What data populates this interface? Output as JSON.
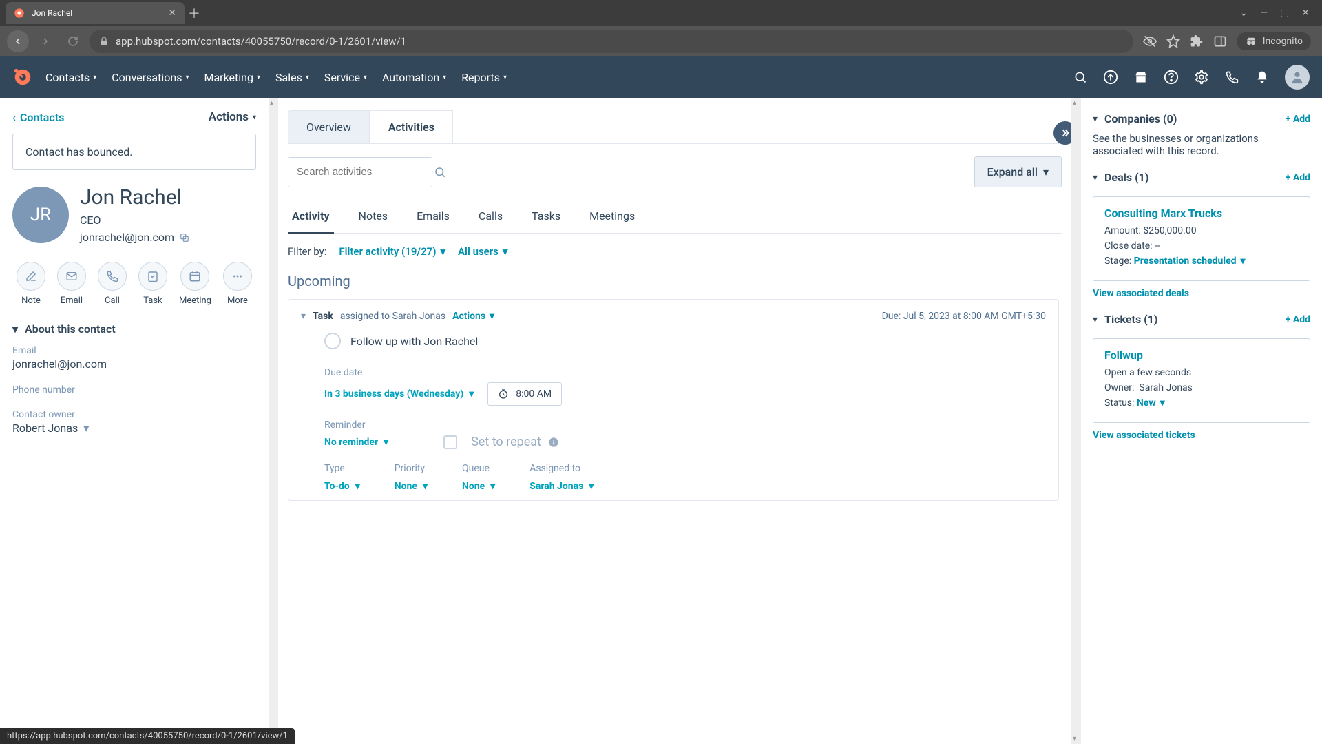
{
  "browser": {
    "tab_title": "Jon Rachel",
    "url": "app.hubspot.com/contacts/40055750/record/0-1/2601/view/1",
    "incognito_label": "Incognito",
    "window_min": "—",
    "window_max": "▢",
    "window_close": "✕"
  },
  "topnav": {
    "items": [
      "Contacts",
      "Conversations",
      "Marketing",
      "Sales",
      "Service",
      "Automation",
      "Reports"
    ]
  },
  "left": {
    "back_label": "Contacts",
    "actions_label": "Actions",
    "bounce_msg": "Contact has bounced.",
    "initials": "JR",
    "name": "Jon Rachel",
    "title": "CEO",
    "email": "jonrachel@jon.com",
    "actions": [
      "Note",
      "Email",
      "Call",
      "Task",
      "Meeting",
      "More"
    ],
    "about_header": "About this contact",
    "fields": {
      "email_label": "Email",
      "email_value": "jonrachel@jon.com",
      "phone_label": "Phone number",
      "phone_value": "",
      "owner_label": "Contact owner",
      "owner_value": "Robert Jonas"
    }
  },
  "middle": {
    "tabs": [
      "Overview",
      "Activities"
    ],
    "search_placeholder": "Search activities",
    "expand_all": "Expand all",
    "sub_tabs": [
      "Activity",
      "Notes",
      "Emails",
      "Calls",
      "Tasks",
      "Meetings"
    ],
    "filter_by": "Filter by:",
    "filter_activity": "Filter activity (19/27)",
    "all_users": "All users",
    "upcoming": "Upcoming",
    "task": {
      "kind": "Task",
      "assigned_to_prefix": "assigned to",
      "assigned_to": "Sarah Jonas",
      "actions": "Actions",
      "due_label": "Due:",
      "due_value": "Jul 5, 2023 at 8:00 AM GMT+5:30",
      "title": "Follow up with Jon Rachel",
      "due_date_label": "Due date",
      "due_date_value": "In 3 business days (Wednesday)",
      "due_time": "8:00 AM",
      "reminder_label": "Reminder",
      "reminder_value": "No reminder",
      "repeat_label": "Set to repeat",
      "type_label": "Type",
      "type_value": "To-do",
      "priority_label": "Priority",
      "priority_value": "None",
      "queue_label": "Queue",
      "queue_value": "None",
      "assignee_label": "Assigned to",
      "assignee_value": "Sarah Jonas"
    }
  },
  "right": {
    "companies": {
      "title": "Companies (0)",
      "add": "+ Add",
      "body": "See the businesses or organizations associated with this record."
    },
    "deals": {
      "title": "Deals (1)",
      "add": "+ Add",
      "name": "Consulting Marx Trucks",
      "amount_label": "Amount:",
      "amount_value": "$250,000.00",
      "close_label": "Close date:",
      "close_value": "--",
      "stage_label": "Stage:",
      "stage_value": "Presentation scheduled",
      "view_link": "View associated deals"
    },
    "tickets": {
      "title": "Tickets (1)",
      "add": "+ Add",
      "name": "Follwup",
      "open_line": "Open a few seconds",
      "owner_label": "Owner:",
      "owner_value": "Sarah Jonas",
      "status_label": "Status:",
      "status_value": "New",
      "view_link": "View associated tickets"
    }
  },
  "status_url": "https://app.hubspot.com/contacts/40055750/record/0-1/2601/view/1"
}
